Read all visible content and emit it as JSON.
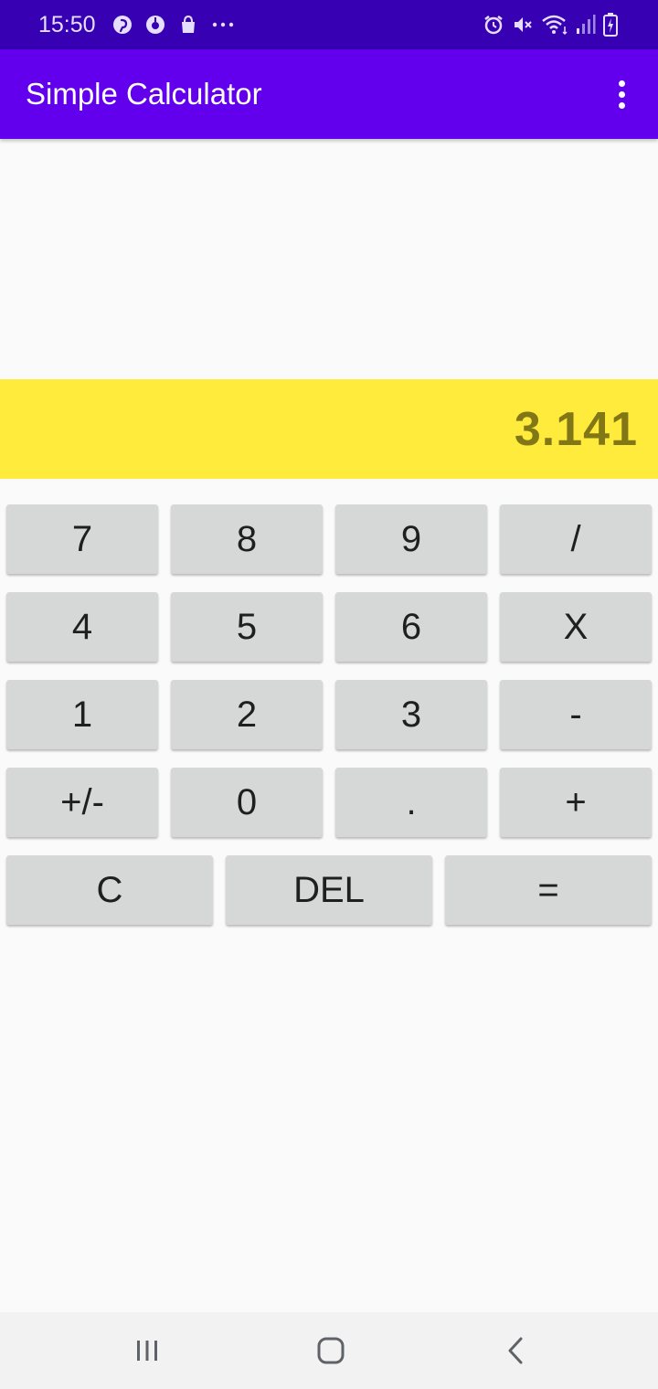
{
  "status_bar": {
    "time": "15:50",
    "left_icons": [
      "pinterest-icon",
      "pinduoduo-icon",
      "shopping-bag-icon",
      "more-dots-icon"
    ],
    "right_icons": [
      "alarm-icon",
      "mute-icon",
      "wifi-icon",
      "signal-icon",
      "battery-icon"
    ]
  },
  "app_bar": {
    "title": "Simple Calculator",
    "overflow_icon": "more-vert-icon"
  },
  "display": {
    "value": "3.141"
  },
  "keypad": {
    "rows": [
      [
        "7",
        "8",
        "9",
        "/"
      ],
      [
        "4",
        "5",
        "6",
        "X"
      ],
      [
        "1",
        "2",
        "3",
        "-"
      ],
      [
        "+/-",
        "0",
        ".",
        "+"
      ],
      [
        "C",
        "DEL",
        "="
      ]
    ]
  },
  "nav_bar": {
    "buttons": [
      "recents-icon",
      "home-icon",
      "back-icon"
    ]
  },
  "colors": {
    "status_bar": "#3700B3",
    "app_bar": "#6200EE",
    "display_bg": "#FFEB3B",
    "display_text": "#827717",
    "key_bg": "#D6D7D7",
    "background": "#FAFAFA"
  }
}
